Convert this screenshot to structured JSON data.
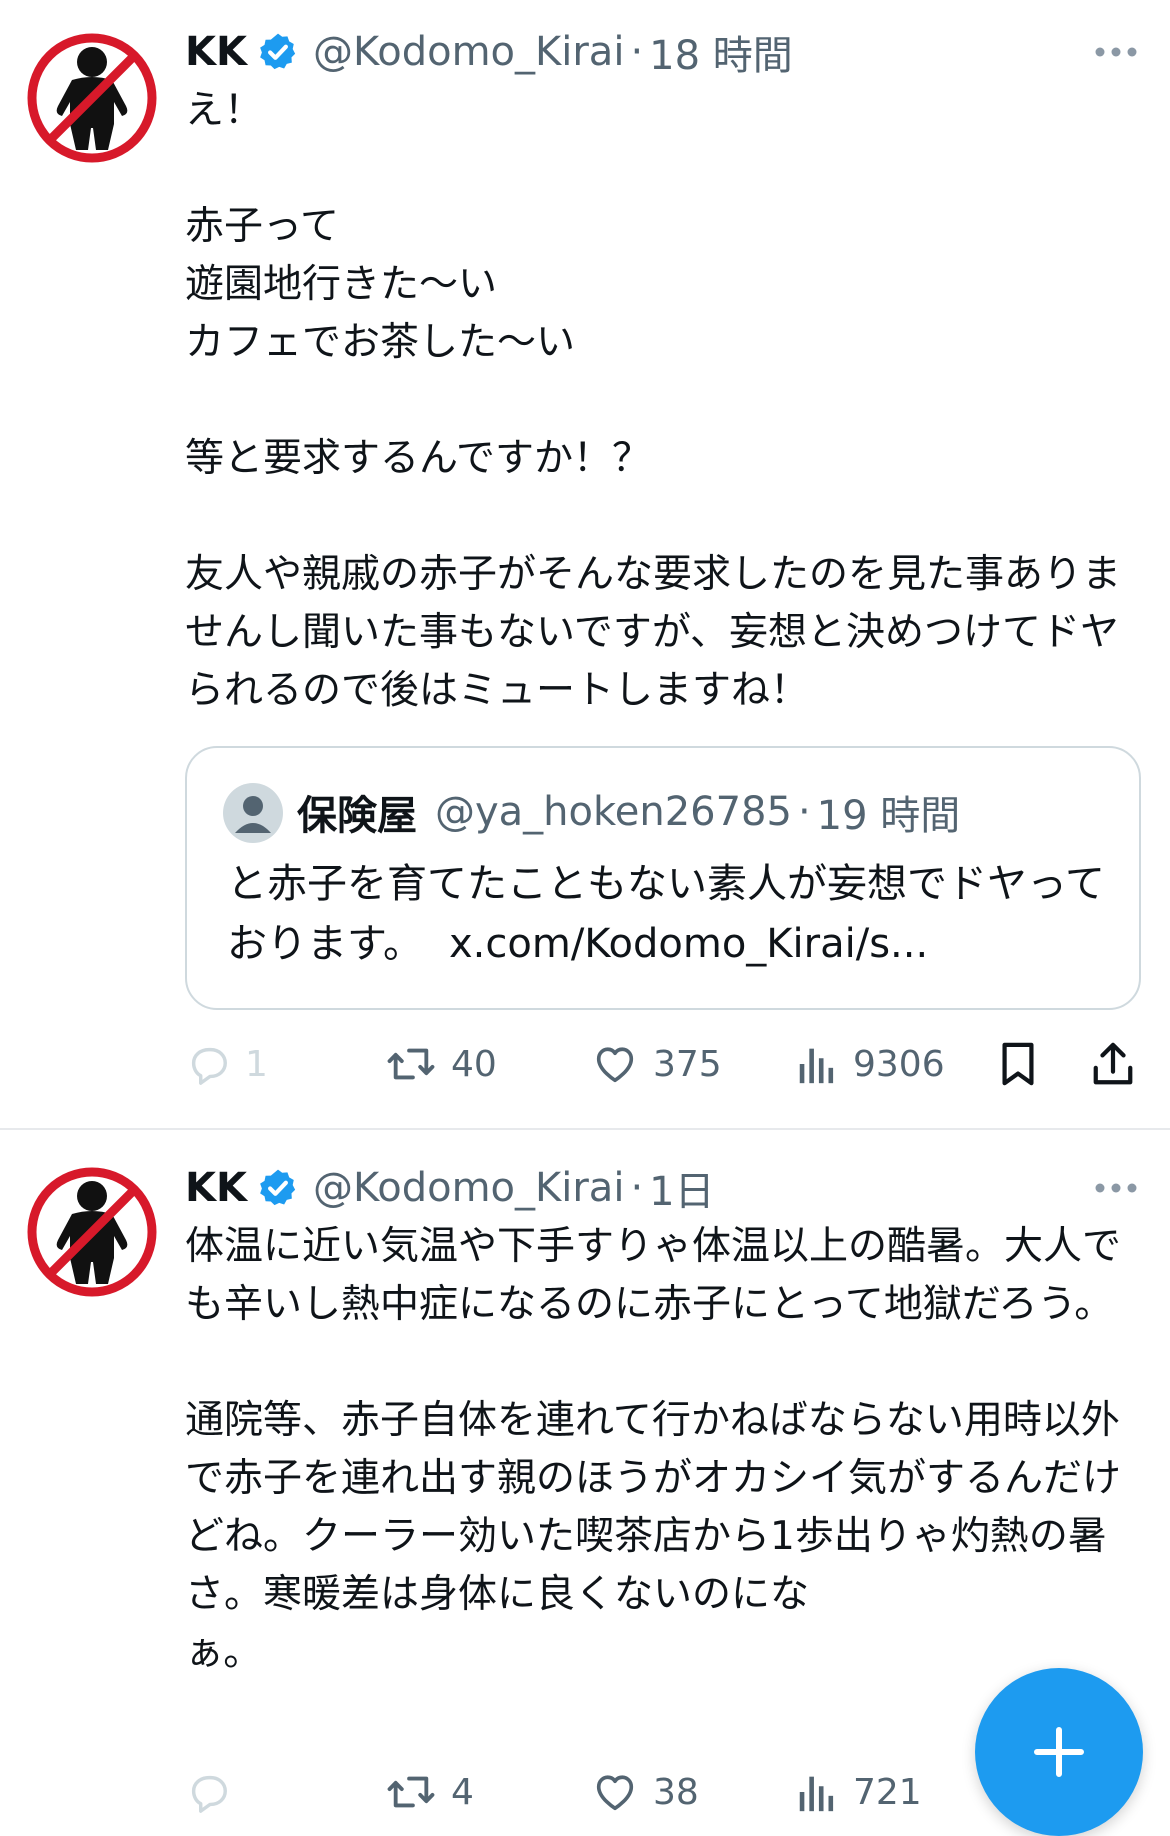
{
  "tweets": [
    {
      "name": "KK",
      "handle": "@Kodomo_Kirai",
      "separator": "·",
      "time": "18 時間",
      "text": "え！\n\n赤子って\n遊園地行きた〜い\nカフェでお茶した〜い\n\n等と要求するんですか！？\n\n友人や親戚の赤子がそんな要求したのを見た事ありませんし聞いた事もないですが、妄想と決めつけてドヤられるので後はミュートしますね！",
      "quote": {
        "name": "保険屋",
        "handle": "@ya_hoken26785",
        "separator": "·",
        "time": "19 時間",
        "text": "と赤子を育てたこともない素人が妄想でドヤっております。",
        "link": "x.com/Kodomo_Kirai/s..."
      },
      "metrics": {
        "replies": "1",
        "retweets": "40",
        "likes": "375",
        "views": "9306"
      }
    },
    {
      "name": "KK",
      "handle": "@Kodomo_Kirai",
      "separator": "·",
      "time": "1日",
      "text": "体温に近い気温や下手すりゃ体温以上の酷暑。大人でも辛いし熱中症になるのに赤子にとって地獄だろう。\n\n通院等、赤子自体を連れて行かねばならない用時以外で赤子を連れ出す親のほうがオカシイ気がするんだけどね。クーラー効いた喫茶店から1歩出りゃ灼熱の暑さ。寒暖差は身体に良くないのにな\nぁ。",
      "metrics": {
        "replies": "",
        "retweets": "4",
        "likes": "38",
        "views": "721"
      }
    }
  ],
  "colors": {
    "accent": "#1d9bf0",
    "secondary_text": "#536471",
    "avatar_prohibit_red": "#d7192a",
    "border": "#cfd9de"
  },
  "icons": {
    "verified": "verified-badge-icon",
    "more": "more-horizontal-icon",
    "reply": "reply-bubble-icon",
    "retweet": "retweet-icon",
    "like": "heart-icon",
    "views": "views-bar-chart-icon",
    "bookmark": "bookmark-icon",
    "share": "share-upload-icon",
    "compose": "plus-icon"
  }
}
